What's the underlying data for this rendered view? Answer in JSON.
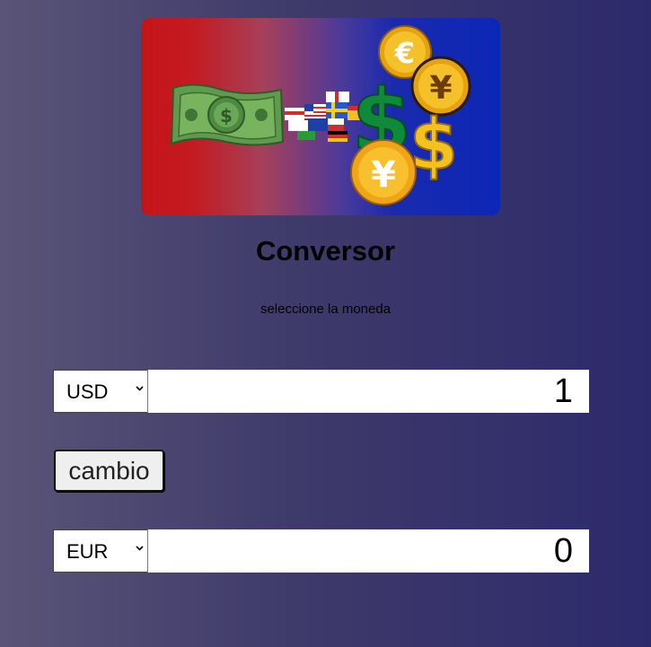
{
  "app": {
    "title": "Conversor",
    "instruction": "seleccione la moneda"
  },
  "from": {
    "currency": "USD",
    "amount": "1"
  },
  "swap_button": {
    "label": "cambio"
  },
  "to": {
    "currency": "EUR",
    "amount": "0"
  },
  "banner": {
    "icons": [
      "banknote-icon",
      "flags-icon",
      "dollar-sign-icon",
      "euro-coin-icon",
      "yen-coin-icon"
    ]
  },
  "colors": {
    "banner_red": "#c4141a",
    "banner_blue": "#0b27b6",
    "background_left": "#5a5478",
    "background_right": "#2d2a6c"
  }
}
